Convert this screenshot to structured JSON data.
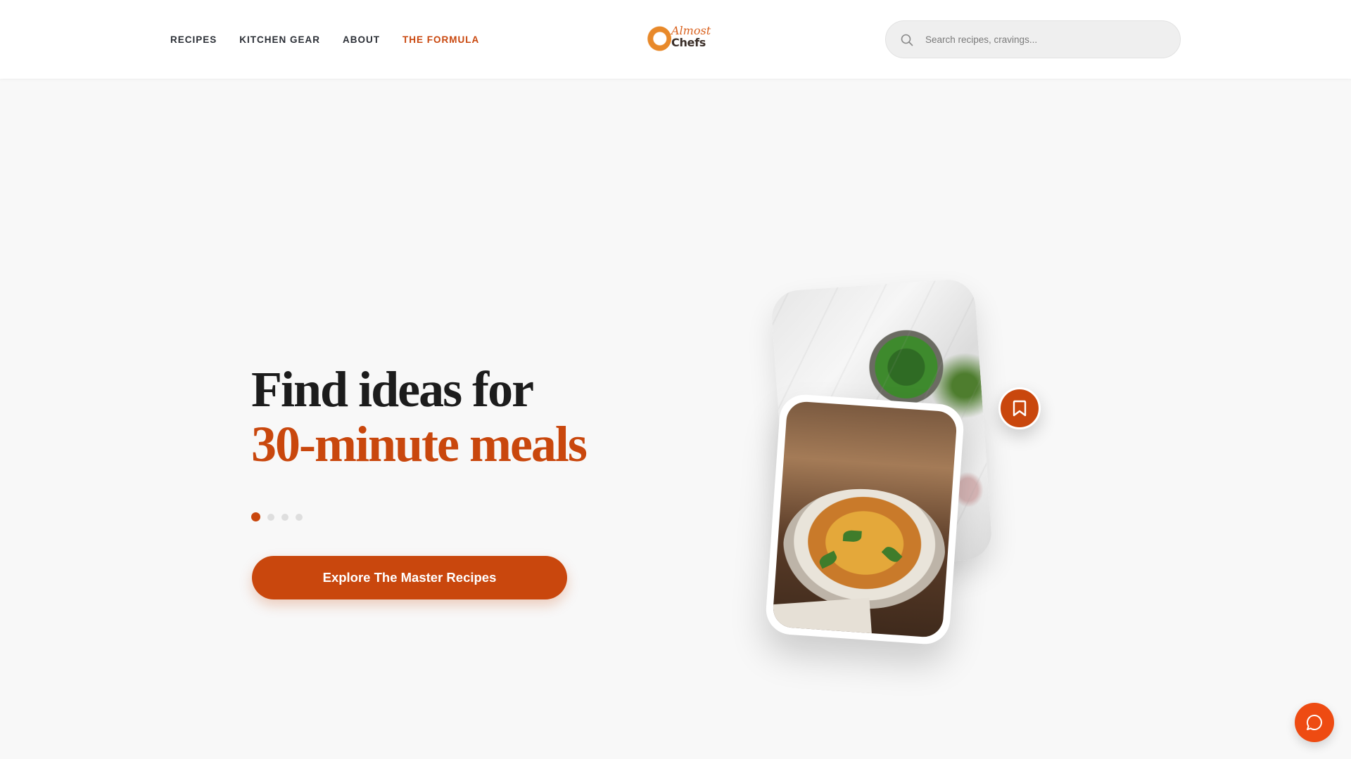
{
  "header": {
    "nav": [
      {
        "label": "RECIPES",
        "active": false
      },
      {
        "label": "KITCHEN GEAR",
        "active": false
      },
      {
        "label": "ABOUT",
        "active": false
      },
      {
        "label": "THE FORMULA",
        "active": true
      }
    ],
    "logo": {
      "word1": "Almost",
      "word2": "Chefs"
    },
    "search": {
      "placeholder": "Search recipes, cravings...",
      "value": "",
      "icon": "search-icon"
    }
  },
  "hero": {
    "title_line1": "Find ideas for",
    "title_line2": "30-minute meals",
    "carousel": {
      "count": 4,
      "active_index": 0
    },
    "cta_label": "Explore The Master Recipes"
  },
  "media": {
    "back_image": "marble-countertop-herbs-photo",
    "front_image": "orecchiette-pasta-bowl-photo",
    "bookmark_icon": "bookmark-icon"
  },
  "chat": {
    "icon": "chat-bubble-icon"
  },
  "colors": {
    "accent": "#c9470d",
    "chat_button": "#ee4b12",
    "background": "#f8f8f8",
    "header_bg": "#ffffff",
    "search_bg": "#efefef"
  }
}
